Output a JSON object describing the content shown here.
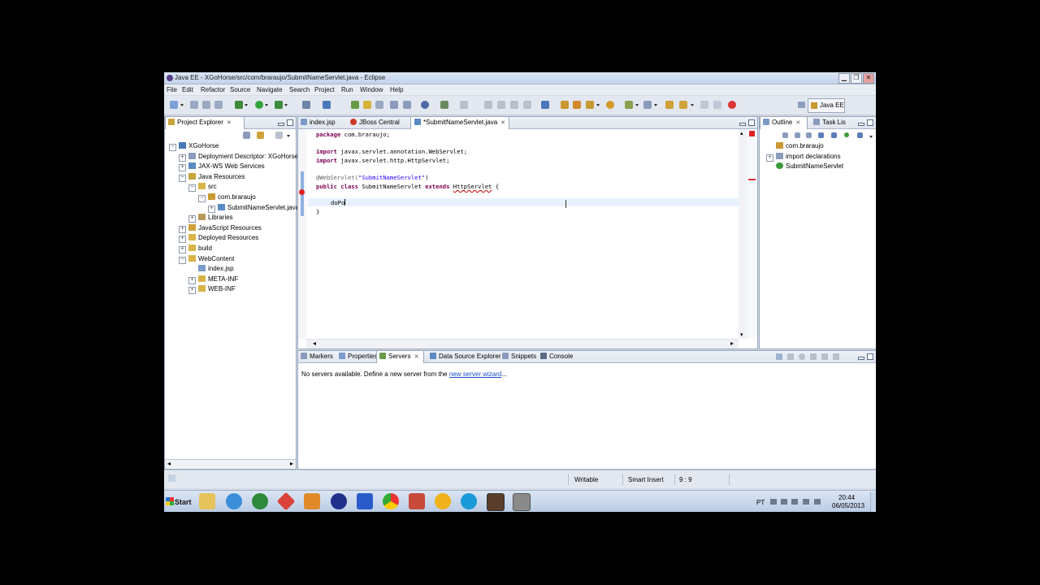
{
  "window": {
    "title": "Java EE - XGoHorse/src/com/braraujo/SubmitNameServlet.java - Eclipse",
    "min": "▁",
    "max": "❐",
    "close": "✕"
  },
  "menu": [
    "File",
    "Edit",
    "Refactor",
    "Source",
    "Navigate",
    "Search",
    "Project",
    "Run",
    "Window",
    "Help"
  ],
  "perspective": {
    "label": "Java EE"
  },
  "project_explorer": {
    "tab": "Project Explorer",
    "items": [
      {
        "label": "XGoHorse",
        "level": 0,
        "exp": "−",
        "icon": "project"
      },
      {
        "label": "Deployment Descriptor: XGoHorse",
        "level": 1,
        "exp": "+",
        "icon": "descriptor"
      },
      {
        "label": "JAX-WS Web Services",
        "level": 1,
        "exp": "+",
        "icon": "webservice"
      },
      {
        "label": "Java Resources",
        "level": 1,
        "exp": "−",
        "icon": "javares"
      },
      {
        "label": "src",
        "level": 2,
        "exp": "−",
        "icon": "folder"
      },
      {
        "label": "com.braraujo",
        "level": 3,
        "exp": "−",
        "icon": "package"
      },
      {
        "label": "SubmitNameServlet.java",
        "level": 4,
        "exp": "+",
        "icon": "javafile"
      },
      {
        "label": "Libraries",
        "level": 2,
        "exp": "+",
        "icon": "library"
      },
      {
        "label": "JavaScript Resources",
        "level": 1,
        "exp": "+",
        "icon": "jsres"
      },
      {
        "label": "Deployed Resources",
        "level": 1,
        "exp": "+",
        "icon": "folder"
      },
      {
        "label": "build",
        "level": 1,
        "exp": "+",
        "icon": "folder"
      },
      {
        "label": "WebContent",
        "level": 1,
        "exp": "−",
        "icon": "folder"
      },
      {
        "label": "index.jsp",
        "level": 2,
        "exp": "",
        "icon": "jsp"
      },
      {
        "label": "META-INF",
        "level": 2,
        "exp": "+",
        "icon": "folder"
      },
      {
        "label": "WEB-INF",
        "level": 2,
        "exp": "+",
        "icon": "folder"
      }
    ]
  },
  "editor": {
    "tabs": [
      "index.jsp",
      "JBoss Central",
      "*SubmitNameServlet.java"
    ],
    "lines": {
      "l1_kw": "package",
      "l1_rest": " com.braraujo;",
      "l2_kw": "import",
      "l2_rest": " javax.servlet.annotation.WebServlet;",
      "l3_kw": "import",
      "l3_rest": " javax.servlet.http.HttpServlet;",
      "l4_ann": "@WebServlet(",
      "l4_str": "\"SubmitNameServlet\"",
      "l4_end": ")",
      "l5_kw1": "public class",
      "l5_mid": " SubmitNameServlet ",
      "l5_kw2": "extends",
      "l5_sp": " ",
      "l5_err": "HttpServlet",
      "l5_end": " {",
      "l6": "doPo",
      "l7": "}"
    }
  },
  "outline": {
    "tabs": [
      "Outline",
      "Task Lis"
    ],
    "items": [
      {
        "label": "com.braraujo",
        "exp": "",
        "icon": "package"
      },
      {
        "label": "import declarations",
        "exp": "+",
        "icon": "imports"
      },
      {
        "label": "SubmitNameServlet",
        "exp": "",
        "icon": "class"
      }
    ]
  },
  "bottom": {
    "tabs": [
      "Markers",
      "Properties",
      "Servers",
      "Data Source Explorer",
      "Snippets",
      "Console"
    ],
    "message": "No servers available. Define a new server from the ",
    "link": "new server wizard",
    "ellipsis": "..."
  },
  "status": {
    "writable": "Writable",
    "insert": "Smart Insert",
    "position": "9 : 9"
  },
  "taskbar": {
    "start": "Start",
    "lang": "PT",
    "time": "20:44",
    "date": "06/05/2013"
  },
  "colors": {
    "accent": "#3a6fb5",
    "keyword": "#7f0055",
    "string": "#2a00ff",
    "error": "#d00000"
  }
}
